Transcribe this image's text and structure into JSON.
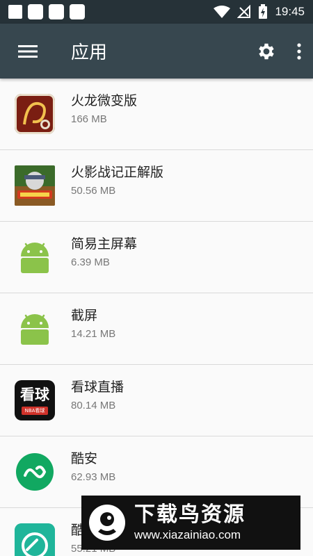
{
  "status_bar": {
    "time": "19:45"
  },
  "app_bar": {
    "title": "应用"
  },
  "apps": [
    {
      "name": "火龙微变版",
      "size": "166 MB",
      "icon": "fire-dragon-app-icon"
    },
    {
      "name": "火影战记正解版",
      "size": "50.56 MB",
      "icon": "naruto-senki-app-icon"
    },
    {
      "name": "简易主屏幕",
      "size": "6.39 MB",
      "icon": "android-robot-icon"
    },
    {
      "name": "截屏",
      "size": "14.21 MB",
      "icon": "android-robot-icon"
    },
    {
      "name": "看球直播",
      "size": "80.14 MB",
      "icon": "kanqiu-app-icon",
      "icon_text": "看球",
      "icon_sub": "NBA看球"
    },
    {
      "name": "酷安",
      "size": "62.93 MB",
      "icon": "coolapk-app-icon"
    },
    {
      "name": "酷",
      "size": "55.21 MB",
      "icon": "coolapk-market-icon"
    }
  ],
  "watermark": {
    "title": "下载鸟资源",
    "url": "www.xiazainiao.com"
  },
  "colors": {
    "status_bar": "#263238",
    "app_bar": "#37474f",
    "android_green": "#8bc34a",
    "coolapk_green": "#11a861",
    "background": "#fafafa"
  }
}
